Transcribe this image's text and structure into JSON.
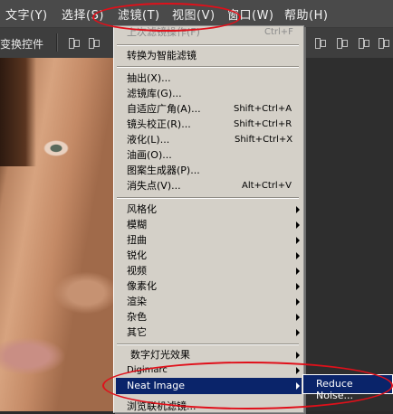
{
  "menubar": {
    "items": [
      {
        "label": "文字(Y)"
      },
      {
        "label": "选择(S)"
      },
      {
        "label": "滤镜(T)"
      },
      {
        "label": "视图(V)"
      },
      {
        "label": "窗口(W)"
      },
      {
        "label": "帮助(H)"
      }
    ]
  },
  "options_bar": {
    "label": "变换控件"
  },
  "filter_menu": {
    "items": [
      {
        "label": "上次滤镜操作(F)",
        "shortcut": "Ctrl+F",
        "disabled": true
      },
      {
        "label": "转换为智能滤镜"
      },
      {
        "label": "抽出(X)..."
      },
      {
        "label": "滤镜库(G)..."
      },
      {
        "label": "自适应广角(A)...",
        "shortcut": "Shift+Ctrl+A"
      },
      {
        "label": "镜头校正(R)...",
        "shortcut": "Shift+Ctrl+R"
      },
      {
        "label": "液化(L)...",
        "shortcut": "Shift+Ctrl+X"
      },
      {
        "label": "油画(O)..."
      },
      {
        "label": "图案生成器(P)..."
      },
      {
        "label": "消失点(V)...",
        "shortcut": "Alt+Ctrl+V"
      },
      {
        "label": "风格化",
        "submenu": true
      },
      {
        "label": "模糊",
        "submenu": true
      },
      {
        "label": "扭曲",
        "submenu": true
      },
      {
        "label": "锐化",
        "submenu": true
      },
      {
        "label": "视频",
        "submenu": true
      },
      {
        "label": "像素化",
        "submenu": true
      },
      {
        "label": "渲染",
        "submenu": true
      },
      {
        "label": "杂色",
        "submenu": true
      },
      {
        "label": "其它",
        "submenu": true
      },
      {
        "label": "数字灯光效果",
        "submenu": true
      },
      {
        "label": "Digimarc",
        "submenu": true
      },
      {
        "label": "Neat Image",
        "submenu": true,
        "highlighted": true
      },
      {
        "label": "浏览联机滤镜..."
      }
    ]
  },
  "neat_image_submenu": {
    "label": "Reduce Noise..."
  },
  "colors": {
    "highlight": "#0a246a",
    "annotation": "#e0101a",
    "menu_bg": "#d4d0c8"
  }
}
